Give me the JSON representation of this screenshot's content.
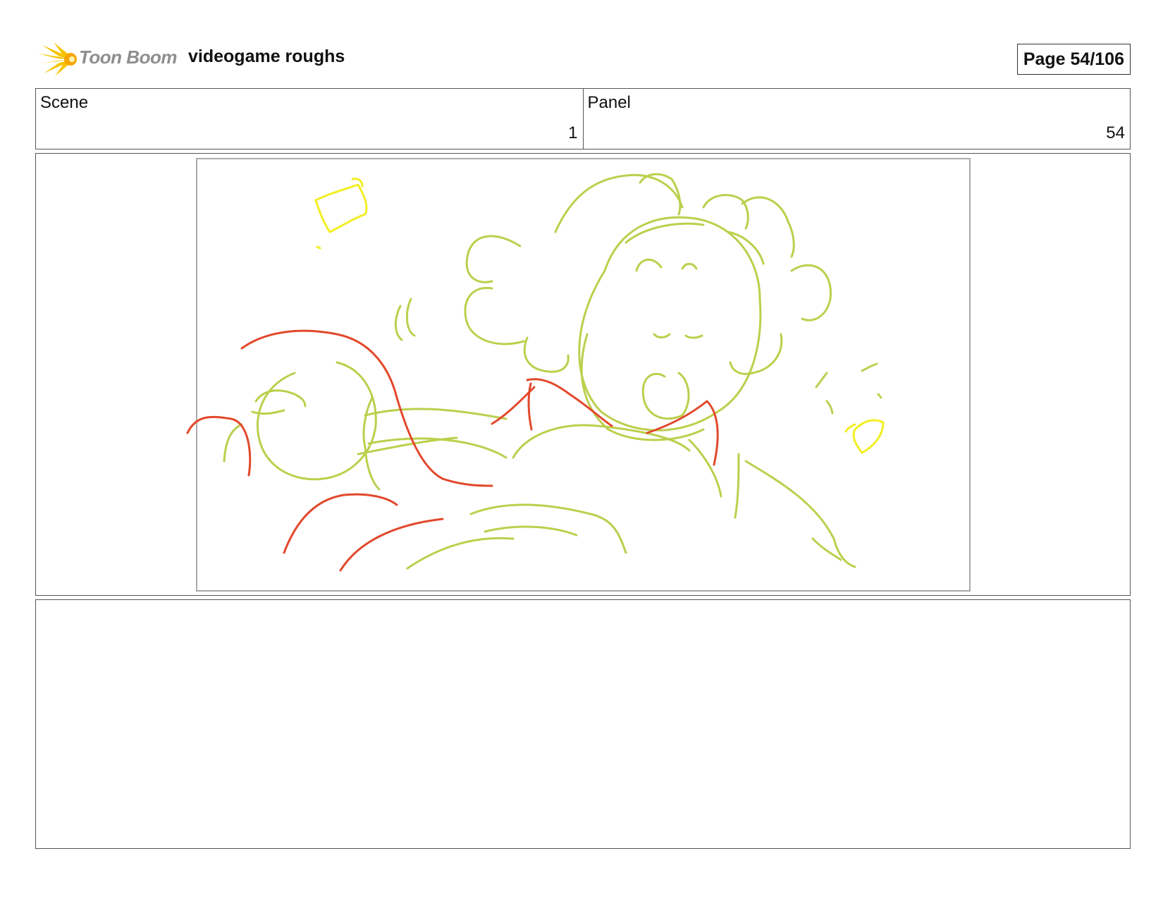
{
  "header": {
    "logo_text": "Toon Boom",
    "title": "videogame roughs",
    "page_label": "Page  54/106"
  },
  "info": {
    "scene_label": "Scene",
    "scene_value": "1",
    "panel_label": "Panel",
    "panel_value": "54"
  },
  "panel": {
    "sketch_colors": {
      "green": "#bccf4c",
      "red": "#e2482c",
      "yellow": "#f3ee23"
    }
  },
  "notes": {
    "text": ""
  }
}
